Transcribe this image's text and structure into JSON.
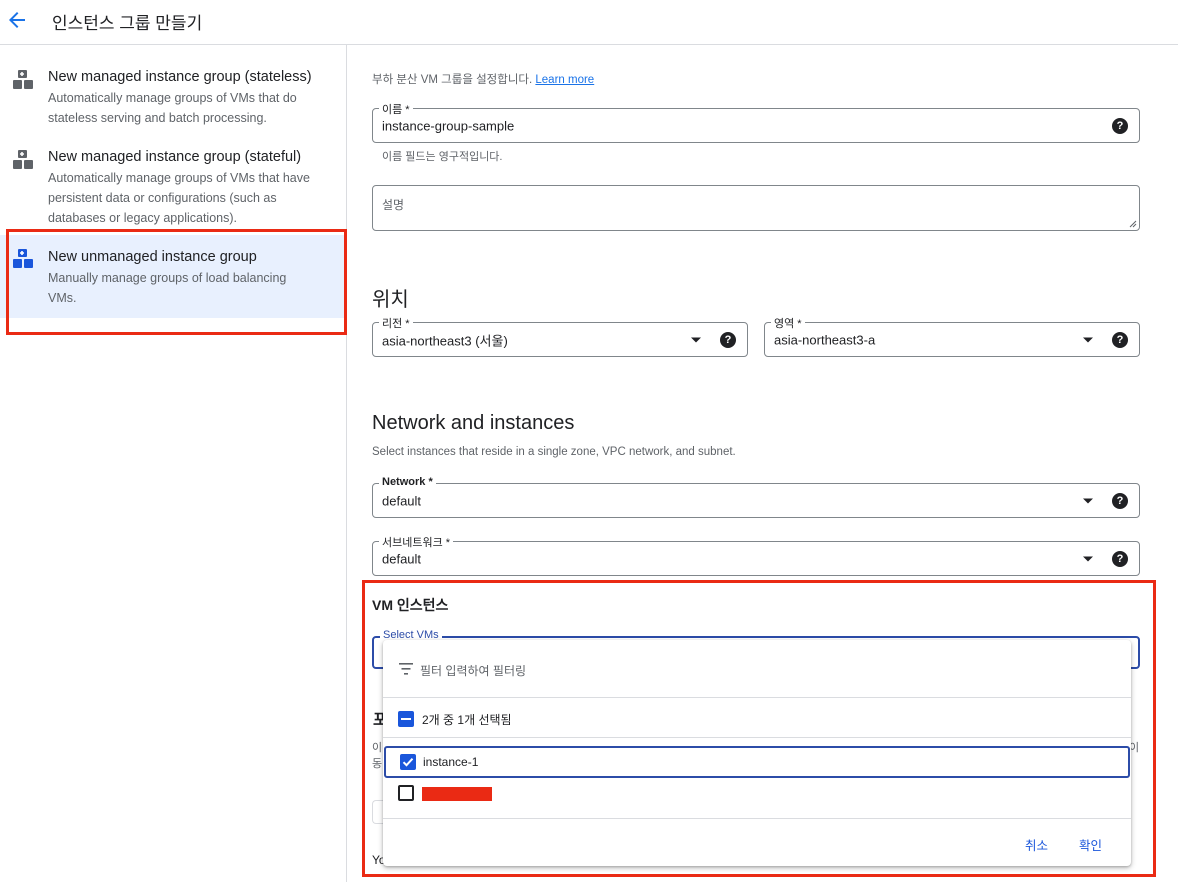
{
  "header": {
    "title": "인스턴스 그룹 만들기"
  },
  "sidebar": {
    "items": [
      {
        "title": "New managed instance group (stateless)",
        "desc_lines": [
          "Automatically manage groups of VMs that do",
          "stateless serving and batch processing."
        ]
      },
      {
        "title": "New managed instance group (stateful)",
        "desc_lines": [
          "Automatically manage groups of VMs that have",
          "persistent data or configurations (such as",
          "databases or legacy applications)."
        ]
      },
      {
        "title": "New unmanaged instance group",
        "desc_lines": [
          "Manually manage groups of load balancing",
          "VMs."
        ]
      }
    ]
  },
  "main": {
    "intro": "부하 분산 VM 그룹을 설정합니다.",
    "learn_more": "Learn more",
    "name_field": {
      "label": "이름 *",
      "value": "instance-group-sample",
      "hint": "이름 필드는 영구적입니다."
    },
    "desc_field": {
      "placeholder": "설명"
    },
    "location": {
      "heading": "위치",
      "region": {
        "label": "리전 *",
        "value": "asia-northeast3 (서울)"
      },
      "zone": {
        "label": "영역 *",
        "value": "asia-northeast3-a"
      }
    },
    "network_section": {
      "heading": "Network and instances",
      "subtitle": "Select instances that reside in a single zone, VPC network, and subnet.",
      "network": {
        "label": "Network *",
        "value": "default"
      },
      "subnetwork": {
        "label": "서브네트워크 *",
        "value": "default"
      }
    },
    "vm_section": {
      "heading": "VM 인스턴스",
      "select_label": "Select VMs",
      "obscured_heading_fragment": "포",
      "obscured_line_start": "이",
      "obscured_line_start2": "동",
      "obscured_line_end": "이",
      "obscured_footer_start": "Yo"
    },
    "dropdown": {
      "filter_placeholder": "필터 입력하여 필터링",
      "selection_summary": "2개 중 1개 선택됨",
      "options": [
        {
          "label": "instance-1",
          "checked": true
        },
        {
          "label": "",
          "checked": false,
          "redacted": true
        }
      ],
      "cancel": "취소",
      "confirm": "확인"
    }
  },
  "colors": {
    "accent": "#1a56db",
    "highlight": "#ea2a14",
    "link": "#1a73e8"
  },
  "icons": {
    "back": "arrow-left-icon",
    "group": "instance-group-icon",
    "help": "help-circle-icon",
    "filter": "filter-list-icon"
  }
}
